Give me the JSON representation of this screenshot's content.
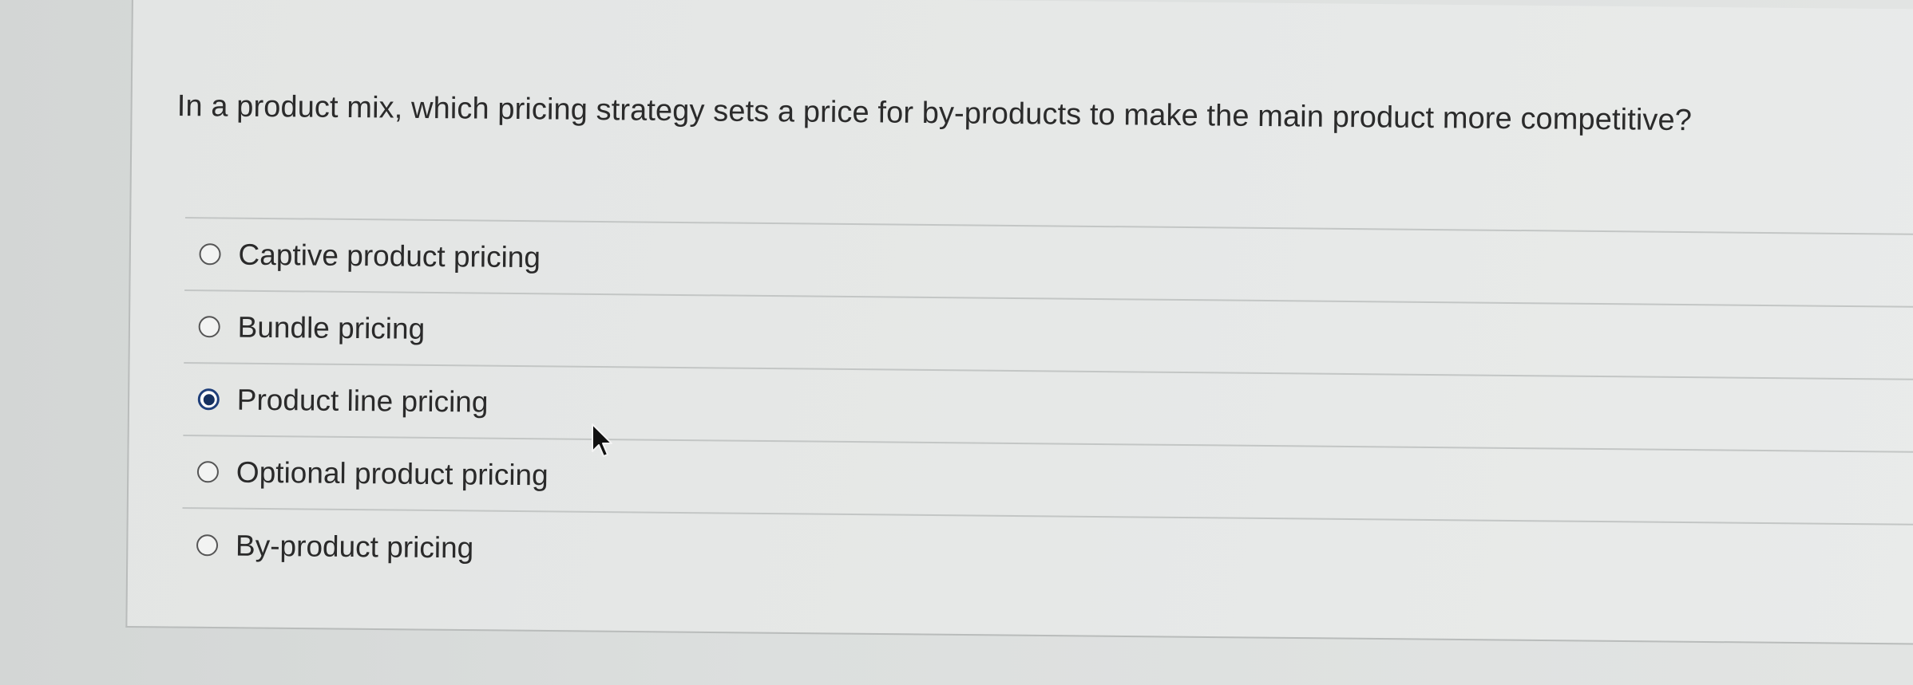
{
  "question": {
    "text": "In a product mix, which pricing strategy sets a price for by-products to make the main product more competitive?"
  },
  "options": [
    {
      "label": "Captive product pricing",
      "selected": false
    },
    {
      "label": "Bundle pricing",
      "selected": false
    },
    {
      "label": "Product line pricing",
      "selected": true
    },
    {
      "label": "Optional product pricing",
      "selected": false
    },
    {
      "label": "By-product pricing",
      "selected": false
    }
  ],
  "colors": {
    "selected_radio": "#15305f",
    "text": "#2a2a2a",
    "background": "#e5e7e6"
  },
  "icons": {
    "cursor": "mouse-pointer-icon"
  }
}
